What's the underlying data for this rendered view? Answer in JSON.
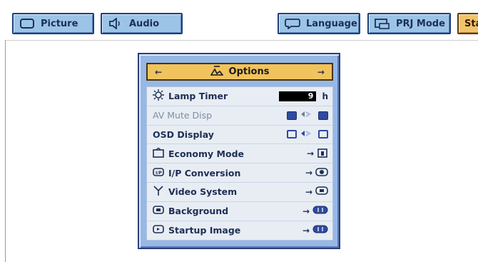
{
  "tabs": {
    "picture": "Picture",
    "audio": "Audio",
    "language": "Language",
    "prj_mode": "PRJ Mode",
    "status": "Sta"
  },
  "panel": {
    "title": "Options",
    "left_arrow": "←",
    "right_arrow": "→",
    "rows": [
      {
        "label": "Lamp Timer",
        "value": "9",
        "unit": "h"
      },
      {
        "label": "AV Mute Disp"
      },
      {
        "label": "OSD Display"
      },
      {
        "label": "Economy Mode"
      },
      {
        "label": "I/P Conversion"
      },
      {
        "label": "Video System"
      },
      {
        "label": "Background"
      },
      {
        "label": "Startup Image"
      }
    ]
  },
  "colors": {
    "panel_bg": "#97b8e6",
    "title_bar": "#f0c35d",
    "tab_bg": "#9cc4e6",
    "tab_border": "#1d3f7c"
  },
  "icons": {
    "picture": "picture-icon",
    "audio": "speaker-icon",
    "language": "speech-bubble-icon",
    "prj_mode": "projector-icon",
    "options_title": "options-icon",
    "lamp_timer": "lamp-icon",
    "economy_mode": "economy-icon",
    "ip_conversion": "ip-icon",
    "video_system": "antenna-icon",
    "background": "background-icon",
    "startup_image": "startup-icon"
  }
}
